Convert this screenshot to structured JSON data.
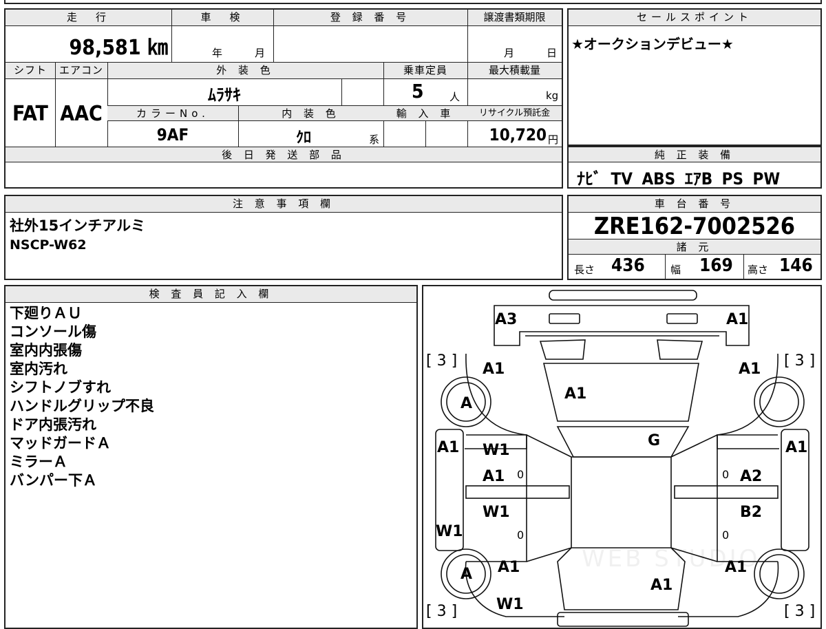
{
  "mileage": {
    "label": "走　行",
    "value": "98,581 ㎞"
  },
  "inspection": {
    "label": "車　検",
    "year": "年",
    "month": "月"
  },
  "registration": {
    "label": "登 録 番 号"
  },
  "transfer": {
    "label": "譲渡書類期限",
    "month": "月",
    "day": "日"
  },
  "sales_point": {
    "label": "セールスポイント",
    "text": "★オークションデビュー★"
  },
  "shift": {
    "label": "シフト",
    "value": "FAT"
  },
  "aircon": {
    "label": "エアコン",
    "value": "AAC"
  },
  "exterior_color": {
    "label": "外 装 色",
    "value": "ﾑﾗｻｷ"
  },
  "capacity": {
    "label": "乗車定員",
    "value": "5",
    "unit": "人"
  },
  "max_load": {
    "label": "最大積載量",
    "unit": "kg"
  },
  "color_no": {
    "label": "カラーNo.",
    "value": "9AF"
  },
  "interior_color": {
    "label": "内 装 色",
    "value": "ｸﾛ",
    "unit": "系"
  },
  "import": {
    "label": "輸 入 車"
  },
  "recycle": {
    "label": "リサイクル預託金",
    "value": "10,720",
    "unit": "円"
  },
  "later_parts": {
    "label": "後 日 発 送 部 品"
  },
  "genuine_equipment": {
    "label": "純 正 装 備",
    "value": "ﾅﾋﾞ TV ABS ｴｱB PS PW"
  },
  "caution": {
    "label": "注 意 事 項 欄",
    "lines": [
      "社外15インチアルミ",
      "NSCP-W62"
    ]
  },
  "chassis": {
    "label": "車 台 番 号",
    "value": "ZRE162-7002526"
  },
  "specs": {
    "label": "諸 元",
    "length_label": "長さ",
    "length": "436",
    "width_label": "幅",
    "width": "169",
    "height_label": "高さ",
    "height": "146"
  },
  "inspector": {
    "label": "検 査 員 記 入 欄",
    "lines": [
      "下廻りＡＵ",
      "コンソール傷",
      "室内内張傷",
      "室内汚れ",
      "シフトノブすれ",
      "ハンドルグリップ不良",
      "ドア内張汚れ",
      "マッドガードＡ",
      "ミラーＡ",
      "バンパー下Ａ"
    ]
  },
  "diagram": {
    "marks": {
      "front_left": "A3",
      "front_right": "A1",
      "tire_fl": "[ 3 ]",
      "tire_fr": "[ 3 ]",
      "tire_rl": "[ 3 ]",
      "tire_rr": "[ 3 ]",
      "fender_fl": "A1",
      "fender_fr": "A1",
      "hood": "A1",
      "wheel_fl": "A",
      "pillar_l": "A1",
      "pillar_r": "A1",
      "windshield": "G",
      "door_fl_top": "W1",
      "door_fl": "A1",
      "door_fr": "A2",
      "door_rl_top": "W1",
      "door_rr": "B2",
      "rocker_l": "W1",
      "wheel_rl": "A",
      "qtr_l": "A1",
      "qtr_r": "A1",
      "trunk": "A1",
      "rear_bumper": "W1",
      "zero1": "0",
      "zero2": "0",
      "zero3": "0",
      "zero4": "0"
    },
    "watermark": "WEB STUDIO"
  }
}
